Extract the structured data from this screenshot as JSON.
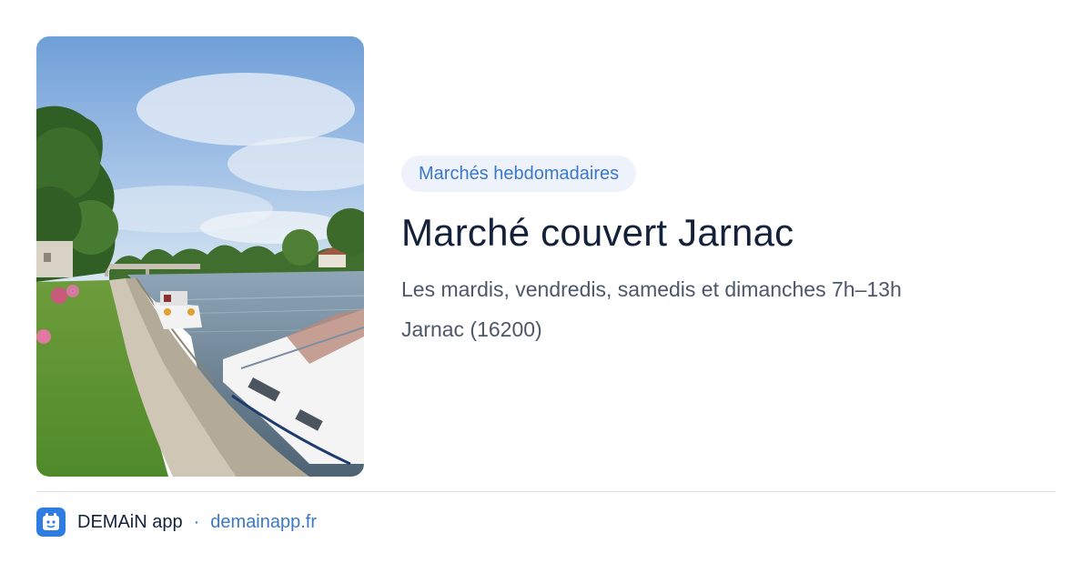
{
  "card": {
    "category": "Marchés hebdomadaires",
    "title": "Marché couvert Jarnac",
    "schedule": "Les mardis, vendredis, samedis et dimanches 7h–13h",
    "location": "Jarnac (16200)"
  },
  "footer": {
    "app_name": "DEMAiN app",
    "separator": "·",
    "domain": "demainapp.fr"
  },
  "colors": {
    "accent": "#3c78c8",
    "chip_bg": "#eef3fb",
    "title": "#14213a",
    "body_text": "#4d5769",
    "divider": "#d9e2e8",
    "app_icon_bg": "#2f7de1"
  },
  "photo": {
    "icon": "riverside-boats-photo"
  }
}
